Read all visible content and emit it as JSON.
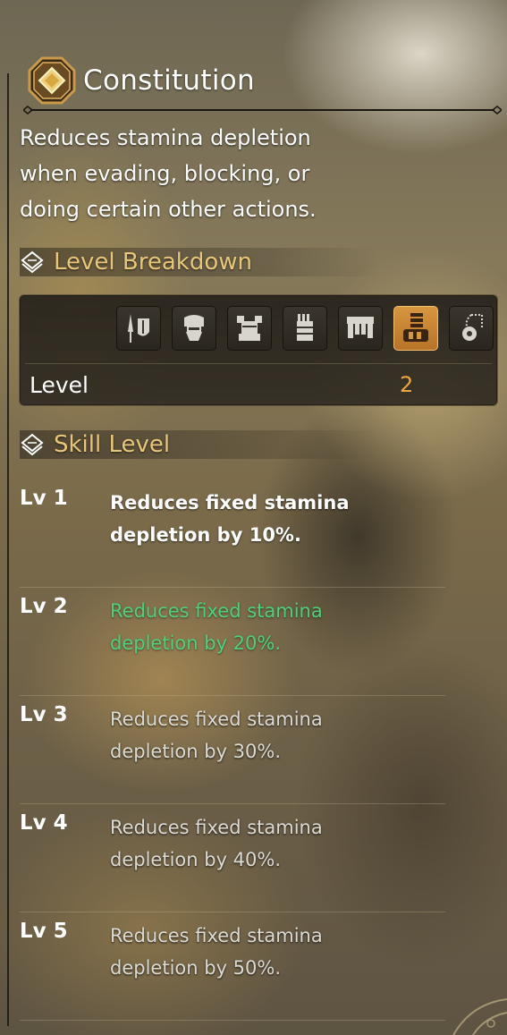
{
  "skill": {
    "name": "Constitution",
    "description": "Reduces stamina depletion when evading, blocking, or doing certain other actions.",
    "icon": "constitution-skill-icon"
  },
  "breakdown": {
    "heading": "Level Breakdown",
    "slots": [
      {
        "icon": "weapon-icon",
        "active": false
      },
      {
        "icon": "helm-icon",
        "active": false
      },
      {
        "icon": "chest-icon",
        "active": false
      },
      {
        "icon": "arms-icon",
        "active": false
      },
      {
        "icon": "waist-icon",
        "active": false
      },
      {
        "icon": "legs-icon",
        "active": true
      },
      {
        "icon": "talisman-icon",
        "active": false
      }
    ],
    "level_label": "Level",
    "level_value": "2",
    "accent_color": "#f0a540"
  },
  "skill_levels": {
    "heading": "Skill Level",
    "rows": [
      {
        "lv": "Lv 1",
        "text": "Reduces fixed stamina depletion by 10%.",
        "state": "done"
      },
      {
        "lv": "Lv 2",
        "text": "Reduces fixed stamina depletion by 20%.",
        "state": "current"
      },
      {
        "lv": "Lv 3",
        "text": "Reduces fixed stamina depletion by 30%.",
        "state": "future"
      },
      {
        "lv": "Lv 4",
        "text": "Reduces fixed stamina depletion by 40%.",
        "state": "future"
      },
      {
        "lv": "Lv 5",
        "text": "Reduces fixed stamina depletion by 50%.",
        "state": "future"
      }
    ],
    "current_color": "#4fd07c"
  }
}
